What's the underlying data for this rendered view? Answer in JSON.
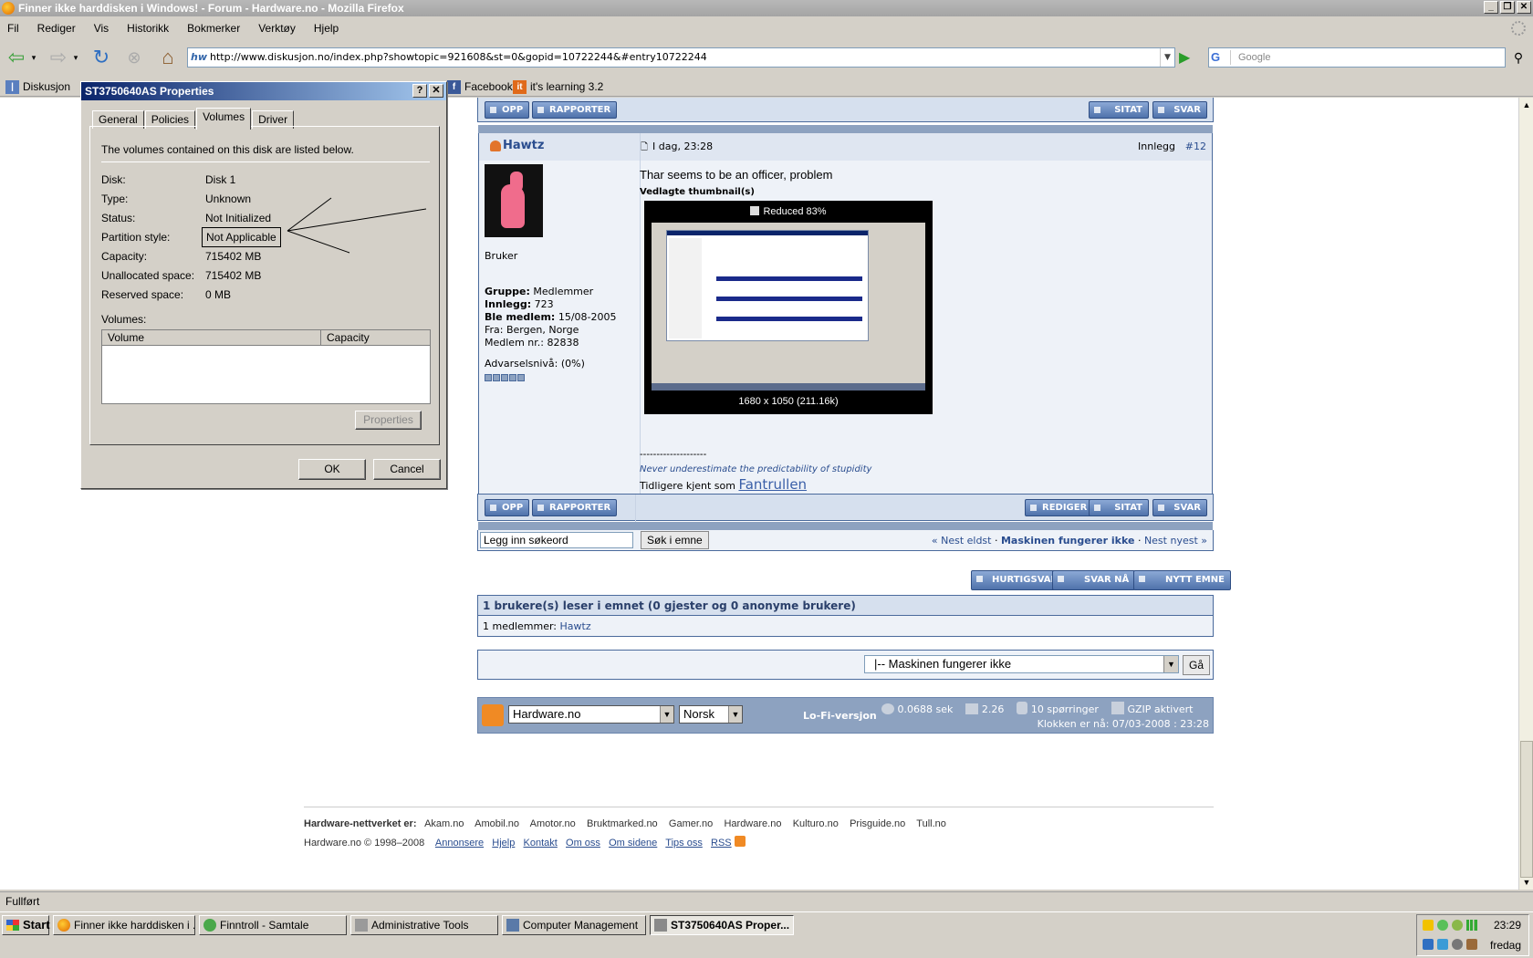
{
  "window": {
    "title": "Finner ikke harddisken i Windows! - Forum - Hardware.no - Mozilla Firefox"
  },
  "menu": [
    "Fil",
    "Rediger",
    "Vis",
    "Historikk",
    "Bokmerker",
    "Verktøy",
    "Hjelp"
  ],
  "nav": {
    "url": "http://www.diskusjon.no/index.php?showtopic=921608&st=0&gopid=10722244&#entry10722244",
    "url_badge": "hw",
    "search_placeholder": "Google",
    "search_engine": "G"
  },
  "bookmarks": {
    "diskusjon": "Diskusjon",
    "facebook": "Facebook",
    "itslearning": "it's learning 3.2"
  },
  "dialog": {
    "title": "ST3750640AS Properties",
    "tabs": [
      "General",
      "Policies",
      "Volumes",
      "Driver"
    ],
    "active_tab": "Volumes",
    "intro": "The volumes contained on this disk are listed below.",
    "fields": [
      {
        "label": "Disk:",
        "value": "Disk 1"
      },
      {
        "label": "Type:",
        "value": "Unknown"
      },
      {
        "label": "Status:",
        "value": "Not Initialized"
      },
      {
        "label": "Partition style:",
        "value": "Not Applicable"
      },
      {
        "label": "Capacity:",
        "value": "715402 MB"
      },
      {
        "label": "Unallocated space:",
        "value": "715402 MB"
      },
      {
        "label": "Reserved space:",
        "value": "0 MB"
      }
    ],
    "volumes_label": "Volumes:",
    "columns": [
      "Volume",
      "Capacity"
    ],
    "properties_button": "Properties",
    "ok": "OK",
    "cancel": "Cancel"
  },
  "forum": {
    "btn_opp": "OPP",
    "btn_rapporter": "RAPPORTER",
    "btn_sitat": "SITAT",
    "btn_svar": "SVAR",
    "btn_rediger": "REDIGER",
    "author": "Hawtz",
    "post_date": "I dag, 23:28",
    "post_number_label": "Innlegg",
    "post_number": "#12",
    "role": "Bruker",
    "group_label": "Gruppe:",
    "group": "Medlemmer",
    "posts_label": "Innlegg:",
    "posts": "723",
    "joined_label": "Ble medlem:",
    "joined": "15/08-2005",
    "from": "Fra: Bergen, Norge",
    "member_no": "Medlem nr.: 82838",
    "warning": "Advarselsnivå: (0%)",
    "message": "Thar seems to be an officer, problem",
    "attachments_label": "Vedlagte thumbnail(s)",
    "thumb_reduced": "Reduced 83%",
    "thumb_size": "1680 x 1050 (211.16k)",
    "sig_line": "--------------------",
    "sig_quote": "Never underestimate the predictability of stupidity",
    "sig_prefix": "Tidligere kjent som",
    "sig_name": "Fantrullen",
    "search_value": "Legg inn søkeord",
    "search_button": "Søk i emne",
    "nav_prev": "« Nest eldst",
    "nav_sep1": "·",
    "topic_title": "Maskinen fungerer ikke",
    "nav_sep2": "·",
    "nav_next": "Nest nyest »",
    "btn_hurtigsvar": "HURTIGSVAR",
    "btn_svar_na": "SVAR NÅ",
    "btn_nytt_emne": "NYTT EMNE",
    "readers_header": "1 brukere(s) leser i emnet (0 gjester og 0 anonyme brukere)",
    "readers_prefix": "1 medlemmer:",
    "readers_user": "Hawtz",
    "jump_select": "|-- Maskinen fungerer ikke",
    "jump_button": "Gå"
  },
  "footer": {
    "skin_select": "Hardware.no",
    "lang_select": "Norsk",
    "lofi": "Lo-Fi-versjon",
    "time": "0.0688 sek",
    "load": "2.26",
    "queries": "10 spørringer",
    "gzip": "GZIP aktivert",
    "clock": "Klokken er nå: 07/03-2008 : 23:28",
    "network_label": "Hardware-nettverket er:",
    "network_links": [
      "Akam.no",
      "Amobil.no",
      "Amotor.no",
      "Bruktmarked.no",
      "Gamer.no",
      "Hardware.no",
      "Kulturo.no",
      "Prisguide.no",
      "Tull.no"
    ],
    "copyright": "Hardware.no © 1998–2008",
    "bottom_links": [
      "Annonsere",
      "Hjelp",
      "Kontakt",
      "Om oss",
      "Om sidene",
      "Tips oss",
      "RSS"
    ]
  },
  "status": "Fullført",
  "taskbar": {
    "start": "Start",
    "items": [
      "Finner ikke harddisken i ...",
      "Finntroll - Samtale",
      "Administrative Tools",
      "Computer Management",
      "ST3750640AS Proper..."
    ],
    "time": "23:29",
    "day": "fredag"
  }
}
